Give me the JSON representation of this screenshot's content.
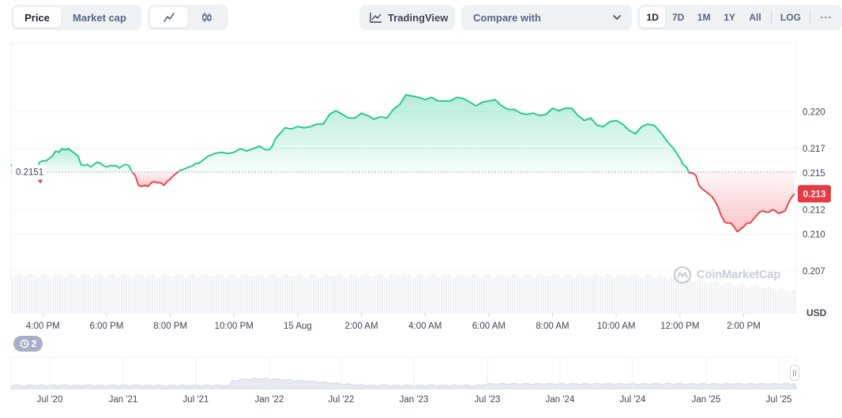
{
  "toolbar": {
    "mode_tabs": [
      {
        "label": "Price",
        "active": true
      },
      {
        "label": "Market cap",
        "active": false
      }
    ],
    "chart_type_tabs": [
      {
        "icon": "line-chart-icon",
        "active": true
      },
      {
        "icon": "candlestick-icon",
        "active": false
      }
    ],
    "tradingview_label": "TradingView",
    "compare_label": "Compare with",
    "ranges": [
      {
        "label": "1D",
        "active": true
      },
      {
        "label": "7D",
        "active": false
      },
      {
        "label": "1M",
        "active": false
      },
      {
        "label": "1Y",
        "active": false
      },
      {
        "label": "All",
        "active": false
      }
    ],
    "log_label": "LOG",
    "more_label": "···"
  },
  "chart_data": {
    "type": "area",
    "y_ticks": [
      "0.220",
      "0.217",
      "0.215",
      "0.212",
      "0.210",
      "0.207"
    ],
    "ylim": [
      0.2055,
      0.2245
    ],
    "x_ticks": [
      "4:00 PM",
      "6:00 PM",
      "8:00 PM",
      "10:00 PM",
      "15 Aug",
      "2:00 AM",
      "4:00 AM",
      "6:00 AM",
      "8:00 AM",
      "10:00 AM",
      "12:00 PM",
      "2:00 PM"
    ],
    "x_tick_positions": [
      1,
      3,
      5,
      7,
      9,
      11,
      13,
      15,
      17,
      19,
      21,
      23
    ],
    "x_range_hours": [
      0,
      24.65
    ],
    "baseline": 0.2151,
    "baseline_label": "0.2151",
    "current_price": 0.2133,
    "current_label": "0.213",
    "unit_label": "USD",
    "colors": {
      "up": "#16c784",
      "down": "#ea3943",
      "baseline": "#b8bfcc"
    },
    "x": [
      0,
      0.1,
      0.2,
      0.3,
      0.4,
      0.5,
      0.6,
      0.7,
      0.8,
      0.9,
      1.0,
      1.1,
      1.2,
      1.3,
      1.4,
      1.5,
      1.6,
      1.7,
      1.8,
      1.9,
      2.0,
      2.1,
      2.2,
      2.3,
      2.4,
      2.5,
      2.6,
      2.7,
      2.8,
      2.9,
      3.0,
      3.1,
      3.2,
      3.3,
      3.4,
      3.5,
      3.6,
      3.7,
      3.8,
      3.9,
      4.0,
      4.1,
      4.2,
      4.3,
      4.4,
      4.5,
      4.6,
      4.7,
      4.8,
      4.9,
      5.0,
      5.1,
      5.2,
      5.3,
      5.4,
      5.5,
      5.6,
      5.7,
      5.8,
      5.9,
      6.0,
      6.2,
      6.4,
      6.6,
      6.8,
      7.0,
      7.2,
      7.4,
      7.6,
      7.8,
      8.0,
      8.1,
      8.2,
      8.3,
      8.4,
      8.5,
      8.6,
      8.8,
      9.0,
      9.2,
      9.4,
      9.6,
      9.8,
      10.0,
      10.2,
      10.4,
      10.6,
      10.8,
      11.0,
      11.2,
      11.4,
      11.6,
      11.8,
      12.0,
      12.2,
      12.4,
      12.6,
      12.8,
      13.0,
      13.2,
      13.4,
      13.6,
      13.8,
      14.0,
      14.2,
      14.4,
      14.6,
      14.8,
      15.0,
      15.2,
      15.4,
      15.6,
      15.8,
      16.0,
      16.2,
      16.4,
      16.6,
      16.8,
      17.0,
      17.2,
      17.4,
      17.6,
      17.8,
      18.0,
      18.2,
      18.4,
      18.6,
      18.8,
      19.0,
      19.2,
      19.4,
      19.6,
      19.8,
      20.0,
      20.2,
      20.4,
      20.6,
      20.8,
      21.0,
      21.1,
      21.2,
      21.3,
      21.4,
      21.5,
      21.6,
      21.7,
      21.8,
      21.9,
      22.0,
      22.1,
      22.2,
      22.3,
      22.4,
      22.5,
      22.6,
      22.7,
      22.8,
      22.9,
      23.0,
      23.1,
      23.2,
      23.3,
      23.4,
      23.5,
      23.6,
      23.7,
      23.8,
      23.9,
      24.0,
      24.1,
      24.2,
      24.3,
      24.4,
      24.5,
      24.6
    ],
    "y": [
      0.2157,
      0.2155,
      0.2156,
      0.2155,
      0.2155,
      0.2154,
      0.215,
      0.2149,
      0.2154,
      0.2159,
      0.216,
      0.216,
      0.2162,
      0.2164,
      0.2168,
      0.2167,
      0.217,
      0.2169,
      0.217,
      0.2168,
      0.2166,
      0.2164,
      0.2157,
      0.2156,
      0.2157,
      0.2155,
      0.2157,
      0.2159,
      0.2158,
      0.2156,
      0.2155,
      0.2156,
      0.2156,
      0.2156,
      0.2154,
      0.2156,
      0.2157,
      0.2156,
      0.2151,
      0.2148,
      0.214,
      0.2139,
      0.214,
      0.2139,
      0.2142,
      0.2143,
      0.2142,
      0.2142,
      0.214,
      0.2143,
      0.2145,
      0.2148,
      0.215,
      0.2152,
      0.2153,
      0.2154,
      0.2155,
      0.2156,
      0.2158,
      0.2158,
      0.216,
      0.2164,
      0.2166,
      0.2167,
      0.2166,
      0.2167,
      0.217,
      0.2168,
      0.217,
      0.2172,
      0.2169,
      0.2169,
      0.2172,
      0.2178,
      0.2181,
      0.2184,
      0.2187,
      0.2186,
      0.2188,
      0.2187,
      0.2188,
      0.219,
      0.219,
      0.2198,
      0.2201,
      0.2198,
      0.2195,
      0.2195,
      0.2199,
      0.2197,
      0.2194,
      0.2196,
      0.2195,
      0.2202,
      0.2206,
      0.2214,
      0.2213,
      0.2212,
      0.221,
      0.2212,
      0.2209,
      0.2209,
      0.2209,
      0.2212,
      0.2211,
      0.2208,
      0.2205,
      0.2208,
      0.2209,
      0.221,
      0.2205,
      0.2202,
      0.2202,
      0.2199,
      0.2198,
      0.2199,
      0.2197,
      0.2198,
      0.2203,
      0.2201,
      0.2203,
      0.2203,
      0.2197,
      0.2193,
      0.2195,
      0.2189,
      0.2188,
      0.2192,
      0.2193,
      0.219,
      0.2185,
      0.2182,
      0.2188,
      0.219,
      0.2189,
      0.2183,
      0.2176,
      0.217,
      0.2162,
      0.2157,
      0.2155,
      0.215,
      0.215,
      0.2148,
      0.214,
      0.2137,
      0.2135,
      0.2133,
      0.2131,
      0.2127,
      0.2122,
      0.2115,
      0.211,
      0.2109,
      0.2109,
      0.2106,
      0.2102,
      0.2104,
      0.2106,
      0.2109,
      0.2109,
      0.2112,
      0.2115,
      0.2118,
      0.2119,
      0.2118,
      0.2118,
      0.212,
      0.2119,
      0.2117,
      0.2118,
      0.2119,
      0.2125,
      0.213,
      0.2133,
      0.2131
    ]
  },
  "history_badge": {
    "icon": "history-icon",
    "count": "2"
  },
  "watermark_text": "CoinMarketCap",
  "navigator": {
    "x_ticks": [
      "Jul '20",
      "Jan '21",
      "Jul '21",
      "Jan '22",
      "Jul '22",
      "Jan '23",
      "Jul '23",
      "Jan '24",
      "Jul '24",
      "Jan '25",
      "Jul '25"
    ]
  }
}
